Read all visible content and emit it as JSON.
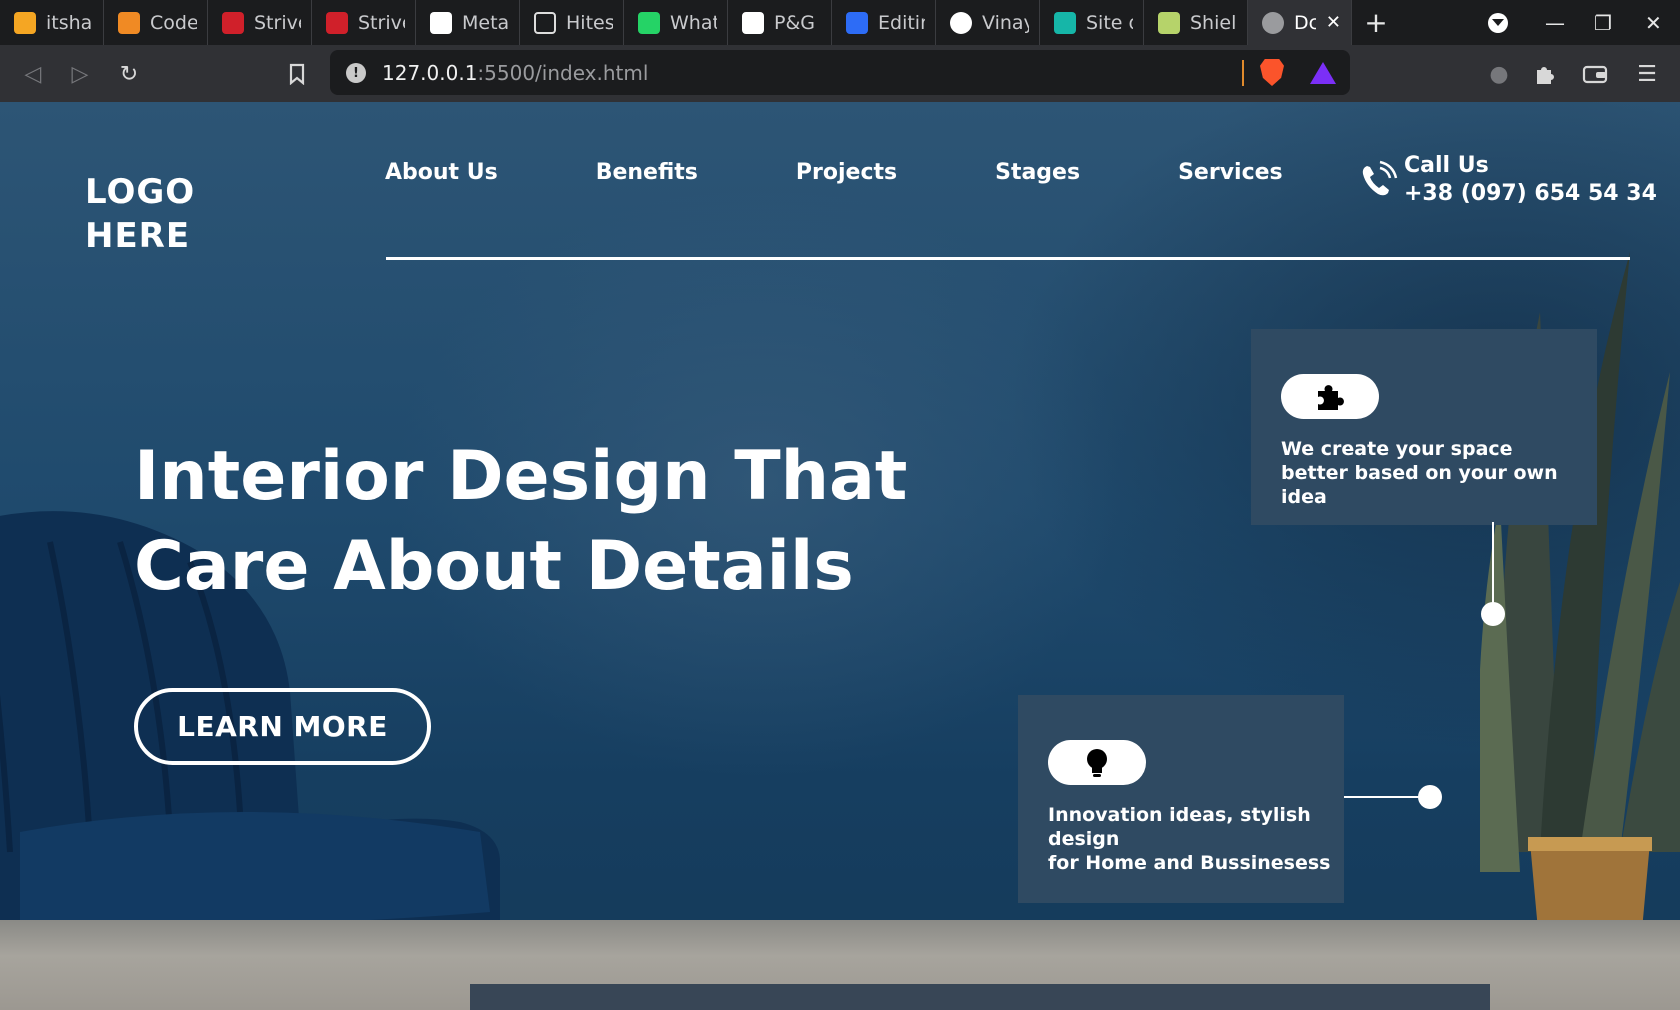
{
  "browser": {
    "tabs": [
      {
        "title": "itshar",
        "icon": "arrow-icon",
        "color": "#f5a623"
      },
      {
        "title": "Code",
        "icon": "code-icon",
        "color": "#f08a24"
      },
      {
        "title": "Strive",
        "icon": "tuf-icon",
        "color": "#d0202a"
      },
      {
        "title": "Strive",
        "icon": "tuf-icon",
        "color": "#d0202a"
      },
      {
        "title": "Meta",
        "icon": "grid-icon",
        "color": "#ffffff"
      },
      {
        "title": "Hitesh",
        "icon": "square-icon",
        "color": "#ffffff"
      },
      {
        "title": "What",
        "icon": "whatsapp-icon",
        "color": "#25d366"
      },
      {
        "title": "P&G F",
        "icon": "pg-icon",
        "color": "#ffffff"
      },
      {
        "title": "Editin",
        "icon": "edit-icon",
        "color": "#2d6cf6"
      },
      {
        "title": "Vinay",
        "icon": "github-icon",
        "color": "#ffffff"
      },
      {
        "title": "Site o",
        "icon": "diamond-icon",
        "color": "#16b6a8"
      },
      {
        "title": "Shield",
        "icon": "shield-icon",
        "color": "#b6d36a"
      },
      {
        "title": "Dc",
        "icon": "globe-icon",
        "color": "#9a9b9e",
        "active": true
      }
    ],
    "url_host": "127.0.0.1",
    "url_path": ":5500/index.html"
  },
  "site": {
    "logo": "LOGO HERE",
    "logo_line1": "LOGO",
    "logo_line2": "HERE",
    "nav": [
      "About Us",
      "Benefits",
      "Projects",
      "Stages",
      "Services"
    ],
    "call_label": "Call Us",
    "phone": "+38 (097) 654 54 34",
    "hero_line1": "Interior Design That",
    "hero_line2": "Care About Details",
    "cta": "LEARN MORE",
    "card1_text": "We create your space better based on your own idea",
    "card2_line1": "Innovation ideas, stylish design",
    "card2_line2": "for Home and Bussinesess",
    "accent_bg": "#1f4a6d",
    "card_bg": "#2f4a62"
  }
}
